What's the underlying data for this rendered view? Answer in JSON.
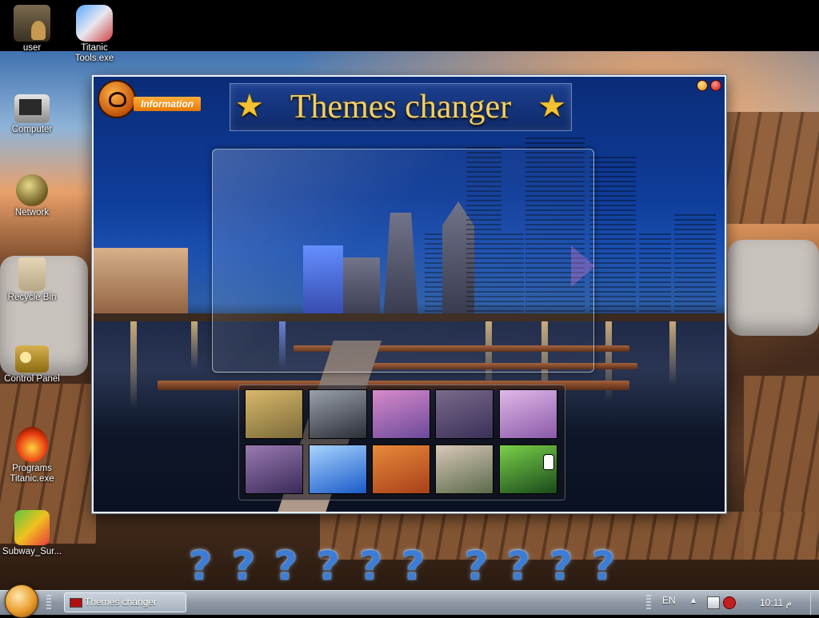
{
  "desktop": {
    "icons": [
      {
        "label": "user",
        "icon": "user-folder-icon"
      },
      {
        "label": "Titanic Tools.exe",
        "icon": "titanic-tools-icon"
      },
      {
        "label": "Computer",
        "icon": "computer-icon"
      },
      {
        "label": "Network",
        "icon": "network-icon"
      },
      {
        "label": "Recycle Bin",
        "icon": "recycle-bin-icon"
      },
      {
        "label": "Control Panel",
        "icon": "control-panel-icon"
      },
      {
        "label": "Programs Titanic.exe",
        "icon": "programs-titanic-icon"
      },
      {
        "label": "Subway_Sur...",
        "icon": "subway-surfers-icon"
      }
    ]
  },
  "window": {
    "title": "Themes changer",
    "info_label": "Information",
    "thumbnails": [
      {
        "name": "theme-rose",
        "color1": "#7a6a3a",
        "color2": "#d9b86a"
      },
      {
        "name": "theme-group",
        "color1": "#2a2e36",
        "color2": "#9aa0aa"
      },
      {
        "name": "theme-lake",
        "color1": "#6a4a9a",
        "color2": "#d88acb"
      },
      {
        "name": "theme-pier-dusk",
        "color1": "#3a3058",
        "color2": "#7a6a8a"
      },
      {
        "name": "theme-pagoda",
        "color1": "#8a5aa8",
        "color2": "#e0b8e8"
      },
      {
        "name": "theme-hat-woman",
        "color1": "#3a2a5a",
        "color2": "#9a7ab0"
      },
      {
        "name": "theme-heart-cloud",
        "color1": "#1a5ac8",
        "color2": "#a8d4ff"
      },
      {
        "name": "theme-autumn-path",
        "color1": "#a8401a",
        "color2": "#e88a3a"
      },
      {
        "name": "theme-garden-bridge",
        "color1": "#5a6a4a",
        "color2": "#d8c8b8"
      },
      {
        "name": "theme-green-alley",
        "color1": "#1a4a1a",
        "color2": "#7ad04a"
      }
    ]
  },
  "dock": {
    "items": [
      "?",
      "?",
      "?",
      "?",
      "?",
      "?",
      "?",
      "?",
      "?",
      "?"
    ]
  },
  "taskbar": {
    "task_label": "Themes changer",
    "language": "EN",
    "clock": "10:11 م"
  },
  "colors": {
    "accent_orange": "#e47908",
    "title_gold": "#f0cf6a",
    "window_blue": "#0f3d9a"
  }
}
